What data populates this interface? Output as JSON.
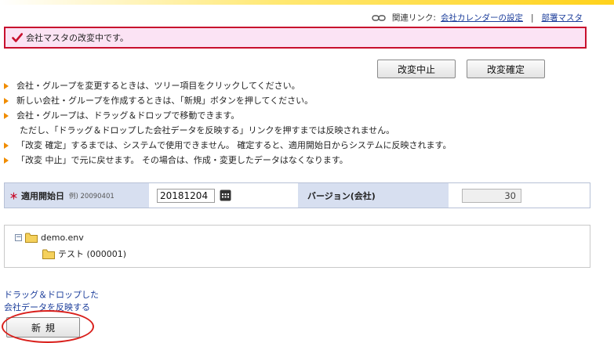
{
  "related": {
    "label": "関連リンク:",
    "calendar_link": "会社カレンダーの設定",
    "separator": "|",
    "dept_link": "部署マスタ"
  },
  "message": {
    "text": "会社マスタの改変中です。"
  },
  "actions": {
    "cancel_label": "改変中止",
    "confirm_label": "改変確定"
  },
  "info": {
    "items": [
      "会社・グループを変更するときは、ツリー項目をクリックしてください。",
      "新しい会社・グループを作成するときは、「新規」ボタンを押してください。",
      "会社・グループは、ドラッグ＆ドロップで移動できます。",
      "ただし、「ドラッグ＆ドロップした会社データを反映する」リンクを押すまでは反映されません。",
      "「改変 確定」するまでは、システムで使用できません。 確定すると、適用開始日からシステムに反映されます。",
      "「改変 中止」で元に戻せます。 その場合は、作成・変更したデータはなくなります。"
    ]
  },
  "form": {
    "required_mark": "＊",
    "start_date_label": "適用開始日",
    "start_date_example": "例) 20090401",
    "start_date_value": "20181204",
    "version_label": "バージョン(会社)",
    "version_value": "30"
  },
  "tree": {
    "root_toggle": "−",
    "root_label": "demo.env",
    "child_label": "テスト (000001)"
  },
  "drag_drop_link": {
    "line1": "ドラッグ＆ドロップした",
    "line2": "会社データを反映する"
  },
  "new_button": {
    "label": "新規"
  },
  "colors": {
    "message_bg": "#fbe3f4",
    "message_border": "#c8102e",
    "form_label_bg": "#d7dff0",
    "bullet": "#f08c00",
    "link": "#1a3c9a",
    "annotation_circle": "#d9201c"
  }
}
